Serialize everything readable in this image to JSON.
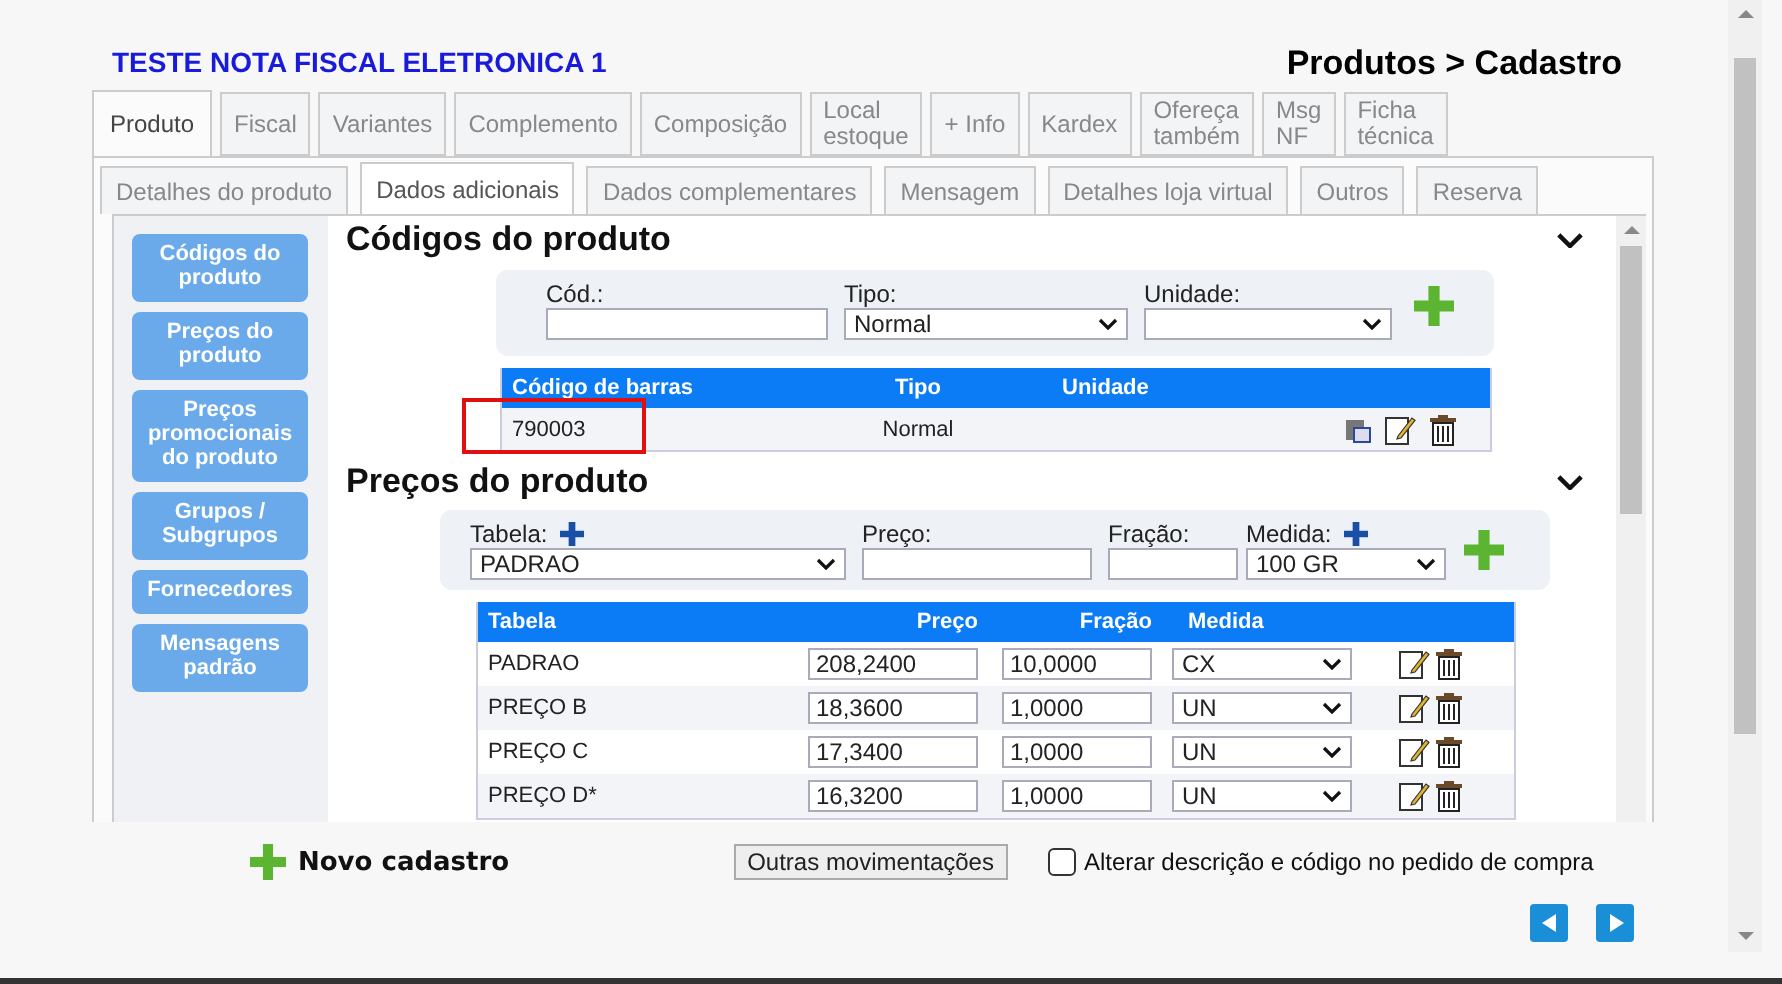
{
  "header": {
    "title": "TESTE NOTA FISCAL ELETRONICA 1",
    "breadcrumb": "Produtos > Cadastro"
  },
  "tabs": [
    {
      "label": "Produto",
      "selected": true
    },
    {
      "label": "Fiscal",
      "selected": false
    },
    {
      "label": "Variantes",
      "selected": false
    },
    {
      "label": "Complemento",
      "selected": false
    },
    {
      "label": "Composição",
      "selected": false
    },
    {
      "label": "Local\nestoque",
      "selected": false
    },
    {
      "label": "+ Info",
      "selected": false
    },
    {
      "label": "Kardex",
      "selected": false
    },
    {
      "label": "Ofereça\ntambém",
      "selected": false
    },
    {
      "label": "Msg\nNF",
      "selected": false
    },
    {
      "label": "Ficha\ntécnica",
      "selected": false
    }
  ],
  "subtabs": [
    {
      "label": "Detalhes do produto",
      "selected": false
    },
    {
      "label": "Dados adicionais",
      "selected": true
    },
    {
      "label": "Dados complementares",
      "selected": false
    },
    {
      "label": "Mensagem",
      "selected": false
    },
    {
      "label": "Detalhes loja virtual",
      "selected": false
    },
    {
      "label": "Outros",
      "selected": false
    },
    {
      "label": "Reserva",
      "selected": false
    }
  ],
  "sidebar": {
    "items": [
      {
        "label": "Códigos do produto"
      },
      {
        "label": "Preços do produto"
      },
      {
        "label": "Preços promocionais do produto"
      },
      {
        "label": "Grupos / Subgrupos"
      },
      {
        "label": "Fornecedores"
      },
      {
        "label": "Mensagens padrão"
      }
    ]
  },
  "codes_section": {
    "title": "Códigos do produto",
    "cod_label": "Cód.:",
    "tipo_label": "Tipo:",
    "tipo_value": "Normal",
    "unidade_label": "Unidade:",
    "columns": [
      "Código de barras",
      "Tipo",
      "Unidade"
    ],
    "rows": [
      {
        "barcode": "790003",
        "tipo": "Normal",
        "highlighted": true
      }
    ]
  },
  "prices_section": {
    "title": "Preços do produto",
    "tabela_label": "Tabela:",
    "tabela_value": "PADRAO",
    "preco_label": "Preço:",
    "fracao_label": "Fração:",
    "medida_label": "Medida:",
    "medida_value": "100 GR",
    "columns": [
      "Tabela",
      "Preço",
      "Fração",
      "Medida"
    ],
    "rows": [
      {
        "tabela": "PADRAO",
        "preco": "208,2400",
        "fracao": "10,0000",
        "medida": "CX"
      },
      {
        "tabela": "PREÇO B",
        "preco": "18,3600",
        "fracao": "1,0000",
        "medida": "UN"
      },
      {
        "tabela": "PREÇO C",
        "preco": "17,3400",
        "fracao": "1,0000",
        "medida": "UN"
      },
      {
        "tabela": "PREÇO D*",
        "preco": "16,3200",
        "fracao": "1,0000",
        "medida": "UN"
      }
    ]
  },
  "footer": {
    "new_label": "Novo cadastro",
    "other_button": "Outras movimentações",
    "checkbox": {
      "label": "Alterar descrição e código no pedido de compra",
      "checked": false
    }
  }
}
